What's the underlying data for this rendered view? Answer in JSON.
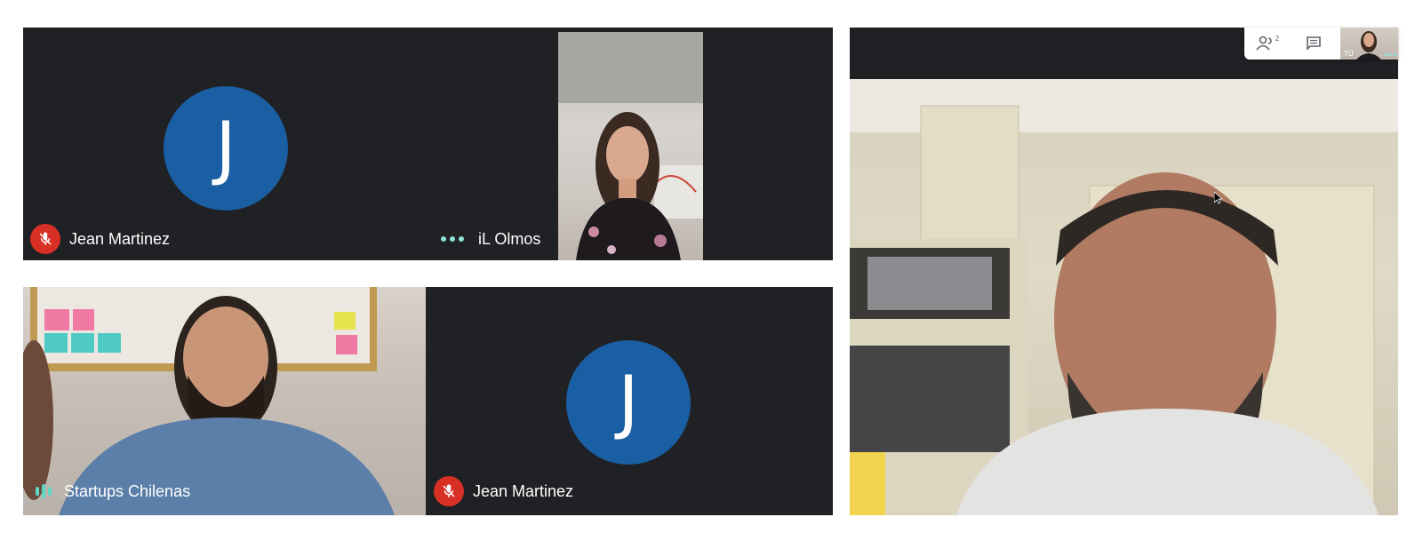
{
  "tiles": {
    "top_left": {
      "avatar_letter": "J",
      "name": "Jean Martinez",
      "mic": "muted"
    },
    "top_right": {
      "name": "iL Olmos",
      "status": "more-options-dots"
    },
    "bottom_left": {
      "name": "Startups Chilenas",
      "status": "speaking"
    },
    "bottom_right": {
      "avatar_letter": "J",
      "name": "Jean Martinez",
      "mic": "muted"
    }
  },
  "toolbar": {
    "people_icon": "people-icon",
    "people_count": "2",
    "chat_icon": "chat-icon",
    "self_label": "TÚ"
  },
  "colors": {
    "tile_bg": "#202124",
    "avatar_bg": "#1a5fa3",
    "mic_off": "#d93025",
    "speaking_accent": "#5fd6c4"
  }
}
